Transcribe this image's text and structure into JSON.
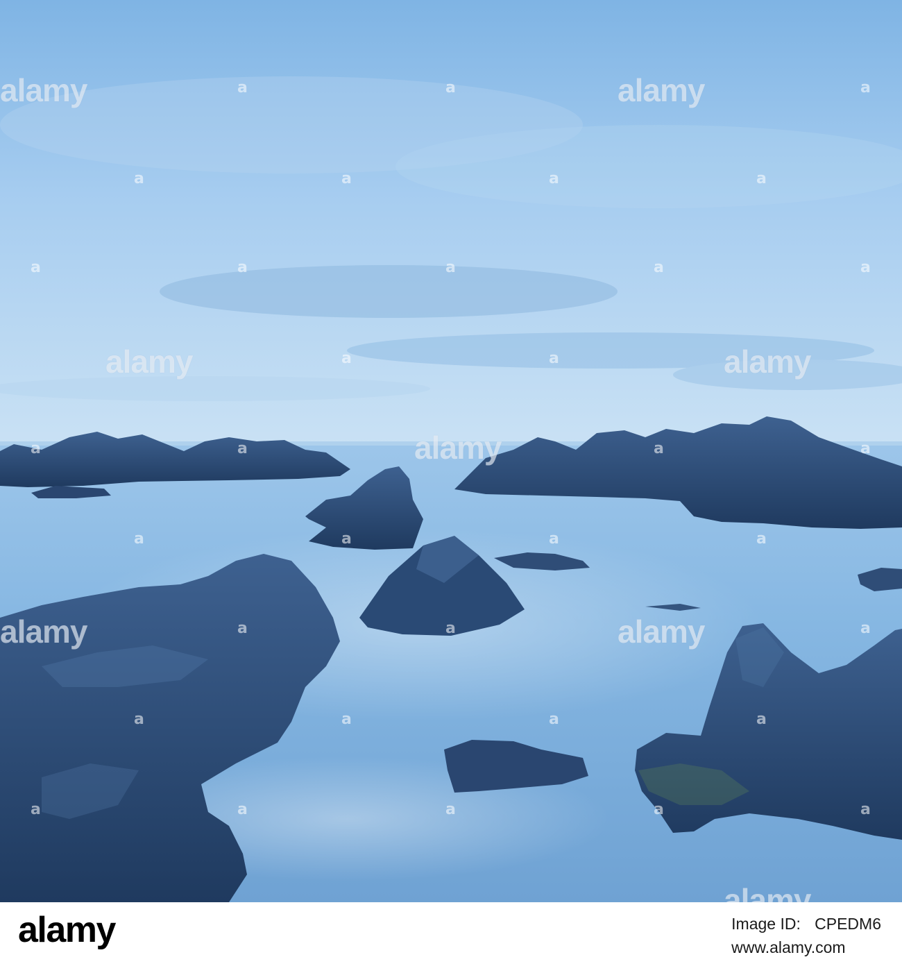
{
  "photo": {
    "subject": "rocky-coastline-long-exposure",
    "colors": {
      "sky_top": "#84b8e6",
      "sky_horizon": "#c2dcf2",
      "water": "#7fb0dc",
      "rock": "#2c4a72"
    }
  },
  "watermark": {
    "word": "alamy",
    "mark": "a"
  },
  "footer": {
    "logo": "alamy",
    "image_id_label": "Image ID:",
    "image_id": "CPEDM6",
    "site": "www.alamy.com"
  }
}
